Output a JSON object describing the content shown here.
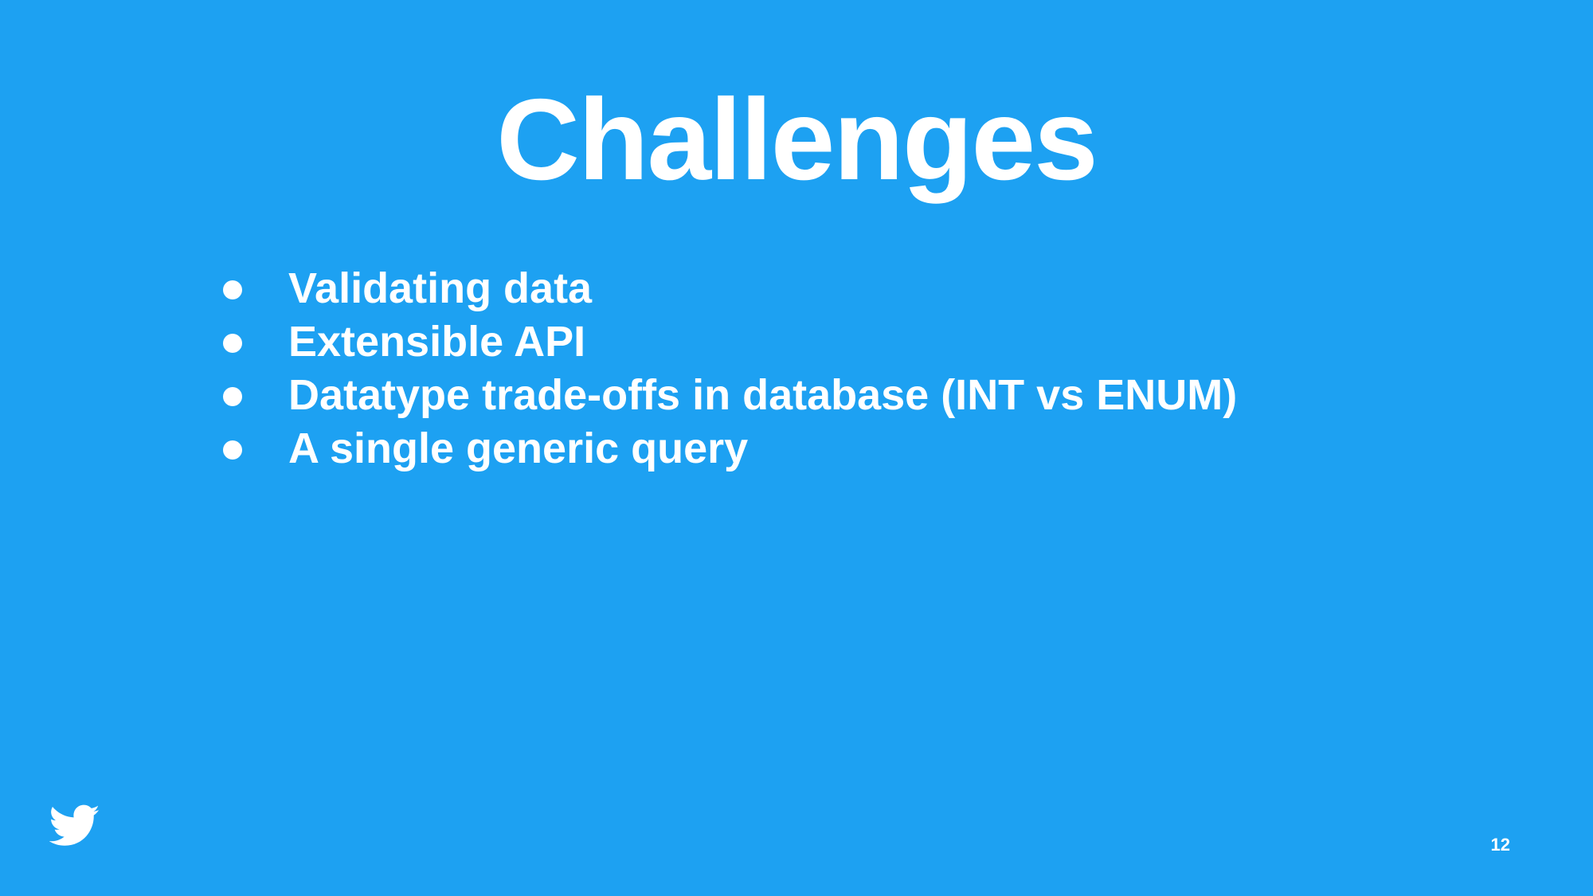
{
  "slide": {
    "title": "Challenges",
    "bullets": [
      "Validating data",
      "Extensible API",
      "Datatype trade-offs in database (INT vs ENUM)",
      "A single generic query"
    ],
    "page_number": "12",
    "logo_icon": "twitter-bird-icon",
    "colors": {
      "background": "#1DA1F2",
      "text": "#FFFFFF"
    }
  }
}
